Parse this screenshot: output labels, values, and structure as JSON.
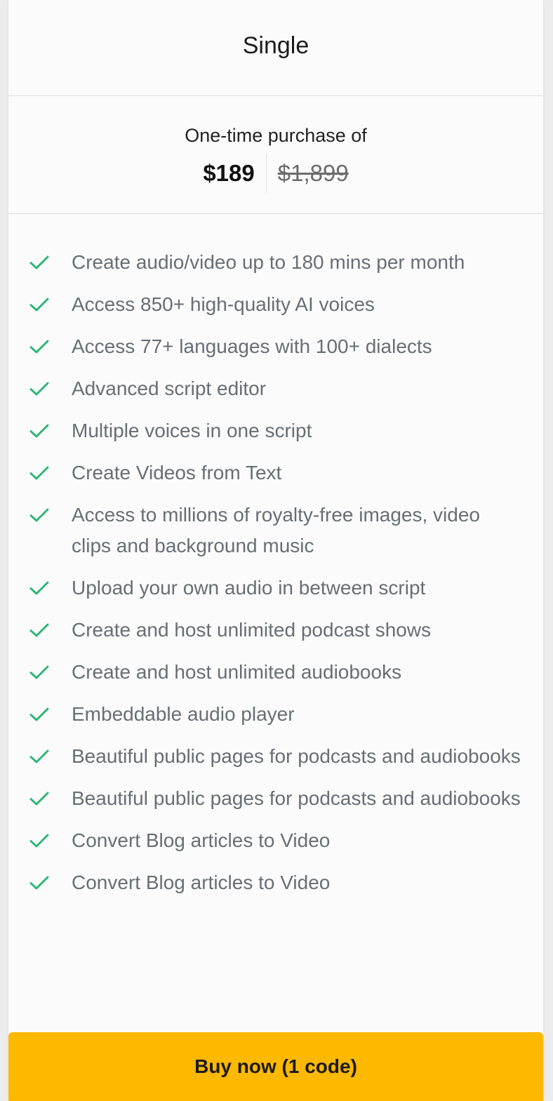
{
  "plan": {
    "title": "Single",
    "price_caption": "One-time purchase of",
    "price_current": "$189",
    "price_original": "$1,899"
  },
  "features": [
    "Create audio/video up to 180 mins per month",
    "Access 850+ high-quality AI voices",
    "Access 77+ languages with 100+ dialects",
    "Advanced script editor",
    "Multiple voices in one script",
    "Create Videos from Text",
    "Access to millions of royalty-free images, video clips and background music",
    "Upload your own audio in between script",
    "Create and host unlimited podcast shows",
    "Create and host unlimited audiobooks",
    "Embeddable audio player",
    "Beautiful public pages for podcasts and audiobooks",
    "Beautiful public pages for podcasts and audiobooks",
    "Convert Blog articles to Video",
    "Convert Blog articles to Video"
  ],
  "feature_icon": "check-icon",
  "button": {
    "label": "Buy now (1 code)"
  },
  "colors": {
    "check": "#2bb673",
    "button_bg": "#fdb800",
    "feature_text": "#686e76"
  }
}
